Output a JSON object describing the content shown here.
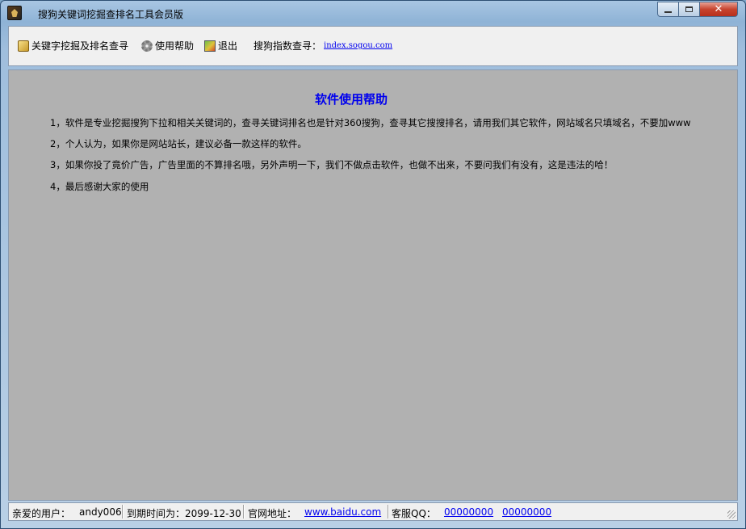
{
  "window": {
    "title": "搜狗关键词挖掘查排名工具会员版",
    "close_glyph": "✕"
  },
  "toolbar": {
    "items": [
      {
        "label": "关键字挖掘及排名查寻",
        "icon": "key-icon"
      },
      {
        "label": "使用帮助",
        "icon": "gear-icon"
      },
      {
        "label": "退出",
        "icon": "exit-icon"
      }
    ],
    "index_label": "搜狗指数查寻：",
    "index_link": "index.sogou.com"
  },
  "help": {
    "title": "软件使用帮助",
    "lines": [
      "1，软件是专业挖掘搜狗下拉和相关关键词的，查寻关键词排名也是针对360搜狗，查寻其它搜搜排名，请用我们其它软件，网站域名只填域名，不要加www",
      "2，个人认为，如果你是网站站长，建议必备一款这样的软件。",
      "3，如果你投了竟价广告，广告里面的不算排名哦，另外声明一下，我们不做点击软件，也做不出来，不要问我们有没有，这是违法的哈！",
      "4，最后感谢大家的使用"
    ]
  },
  "status": {
    "user_label": "亲爱的用户：",
    "user_name": "andy006",
    "expire_label": "到期时间为：2099-12-30",
    "site_label": "官网地址：",
    "site_link": "www.baidu.com",
    "qq_label": "客服QQ：",
    "qq_1": "00000000",
    "qq_2": "00000000"
  },
  "colors": {
    "content_bg": "#b1b1b1",
    "link": "#0000ee",
    "title_bar": "#8fb3d6"
  }
}
